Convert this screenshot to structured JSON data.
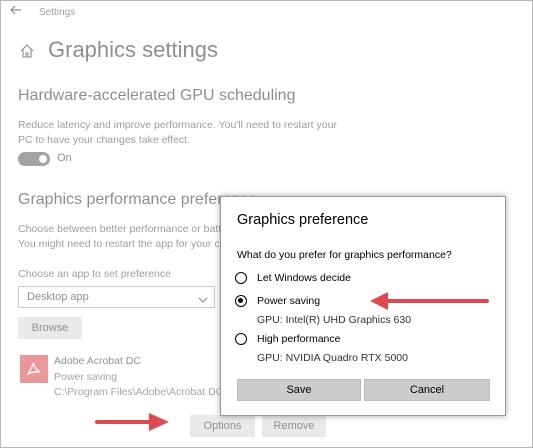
{
  "window": {
    "app_title": "Settings",
    "page_title": "Graphics settings"
  },
  "gpu_scheduling": {
    "heading": "Hardware-accelerated GPU scheduling",
    "description_line1": "Reduce latency and improve performance. You'll need to restart your",
    "description_line2": "PC to have your changes take effect.",
    "toggle_state": "On"
  },
  "performance": {
    "heading": "Graphics performance preference",
    "description_line1": "Choose between better performance or battery life when using an app.",
    "description_line2": "You might need to restart the app for your changes to take effect.",
    "choose_label": "Choose an app to set preference",
    "app_type_selected": "Desktop app",
    "browse_label": "Browse"
  },
  "app_entry": {
    "name": "Adobe Acrobat DC",
    "preference": "Power saving",
    "path": "C:\\Program Files\\Adobe\\Acrobat DC\\Acrobat\\Acrobat.exe",
    "options_label": "Options",
    "remove_label": "Remove"
  },
  "dialog": {
    "title": "Graphics preference",
    "question": "What do you prefer for graphics performance?",
    "options": [
      {
        "label": "Let Windows decide",
        "gpu": "",
        "selected": false
      },
      {
        "label": "Power saving",
        "gpu": "GPU: Intel(R) UHD Graphics 630",
        "selected": true
      },
      {
        "label": "High performance",
        "gpu": "GPU: NVIDIA Quadro RTX 5000",
        "selected": false
      }
    ],
    "save_label": "Save",
    "cancel_label": "Cancel"
  },
  "colors": {
    "annotation_arrow": "#e0494f",
    "pdf_icon": "#d01a1a"
  },
  "icons": [
    "back-arrow-icon",
    "home-icon",
    "chevron-down-icon",
    "pdf-icon",
    "annotation-arrow"
  ]
}
